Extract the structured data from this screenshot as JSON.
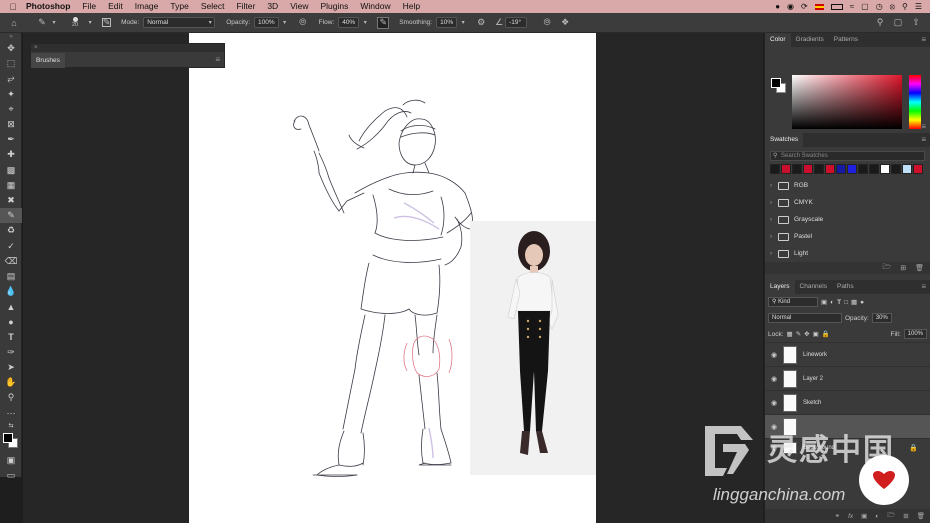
{
  "menubar": {
    "app": "Photoshop",
    "items": [
      "File",
      "Edit",
      "Image",
      "Type",
      "Select",
      "Filter",
      "3D",
      "View",
      "Plugins",
      "Window",
      "Help"
    ]
  },
  "options": {
    "brush_size": "20",
    "mode_label": "Mode:",
    "mode_value": "Normal",
    "opacity_label": "Opacity:",
    "opacity_value": "100%",
    "flow_label": "Flow:",
    "flow_value": "40%",
    "smoothing_label": "Smoothing:",
    "smoothing_value": "10%",
    "angle_value": "-19°"
  },
  "brushes_panel": {
    "tab": "Brushes"
  },
  "color_panel": {
    "tabs": [
      "Color",
      "Gradients",
      "Patterns"
    ],
    "foreground": "#000000",
    "background": "#ffffff",
    "hue_color": "#e0162b"
  },
  "swatches_panel": {
    "tab": "Swatches",
    "search_placeholder": "Search Swatches",
    "recent": [
      "#1a1a1a",
      "#c8102e",
      "#1a1a1a",
      "#c8102e",
      "#1a1a1a",
      "#d0102a",
      "#1a1aa0",
      "#2020e0",
      "#1a1a1a",
      "#1a1a1a",
      "#ffffff",
      "#1a1a1a",
      "#bde0f7",
      "#d0102a"
    ],
    "folders": [
      "RGB",
      "CMYK",
      "Grayscale",
      "Pastel",
      "Light"
    ]
  },
  "layers_panel": {
    "tabs": [
      "Layers",
      "Channels",
      "Paths"
    ],
    "kind_label": "Kind",
    "blend_mode": "Normal",
    "opacity_label": "Opacity:",
    "opacity_value": "30%",
    "lock_label": "Lock:",
    "fill_label": "Fill:",
    "fill_value": "100%",
    "layers": [
      {
        "name": "Linework"
      },
      {
        "name": "Layer 2"
      },
      {
        "name": "Sketch"
      },
      {
        "name": ""
      },
      {
        "name": "Background"
      }
    ]
  },
  "watermark": {
    "chinese": "灵感中国",
    "english": "lingganchina.com"
  }
}
